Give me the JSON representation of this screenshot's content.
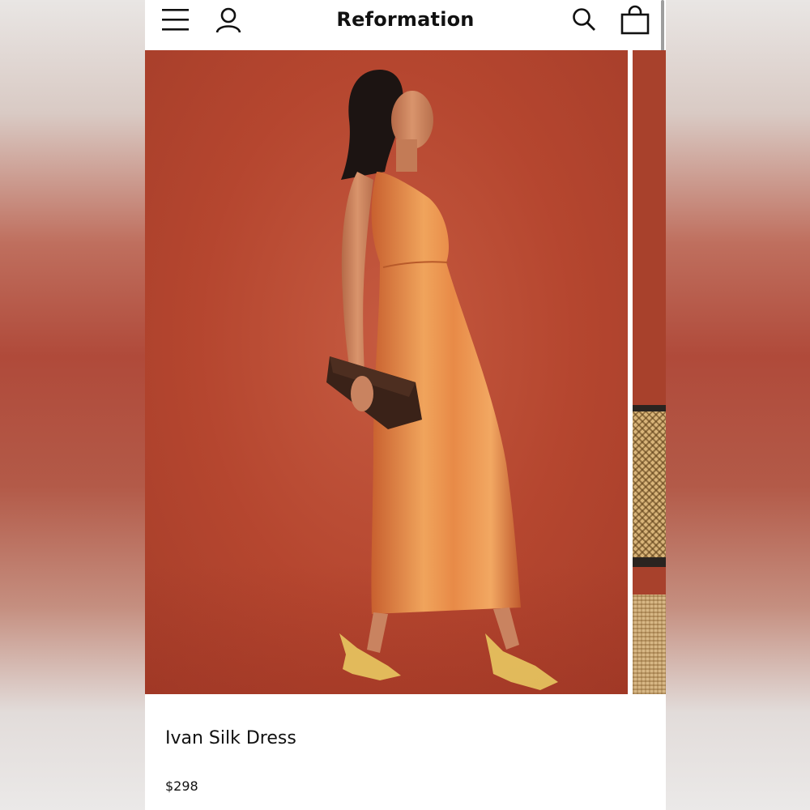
{
  "header": {
    "brand": "Reformation",
    "icons": {
      "menu": "hamburger-menu-icon",
      "account": "user-account-icon",
      "search": "search-icon",
      "bag": "shopping-bag-icon"
    }
  },
  "product": {
    "name": "Ivan Silk Dress",
    "price": "$298",
    "image": {
      "subject": "model in orange silk slip dress holding brown clutch, clear heels",
      "background_color": "#b5462f",
      "dress_color": "#e08a4a"
    },
    "carousel": {
      "current_index": 1,
      "next_image": "rattan chair preview"
    }
  },
  "colors": {
    "text": "#111111",
    "background": "#ffffff",
    "accent_backdrop": "#b5462f"
  }
}
